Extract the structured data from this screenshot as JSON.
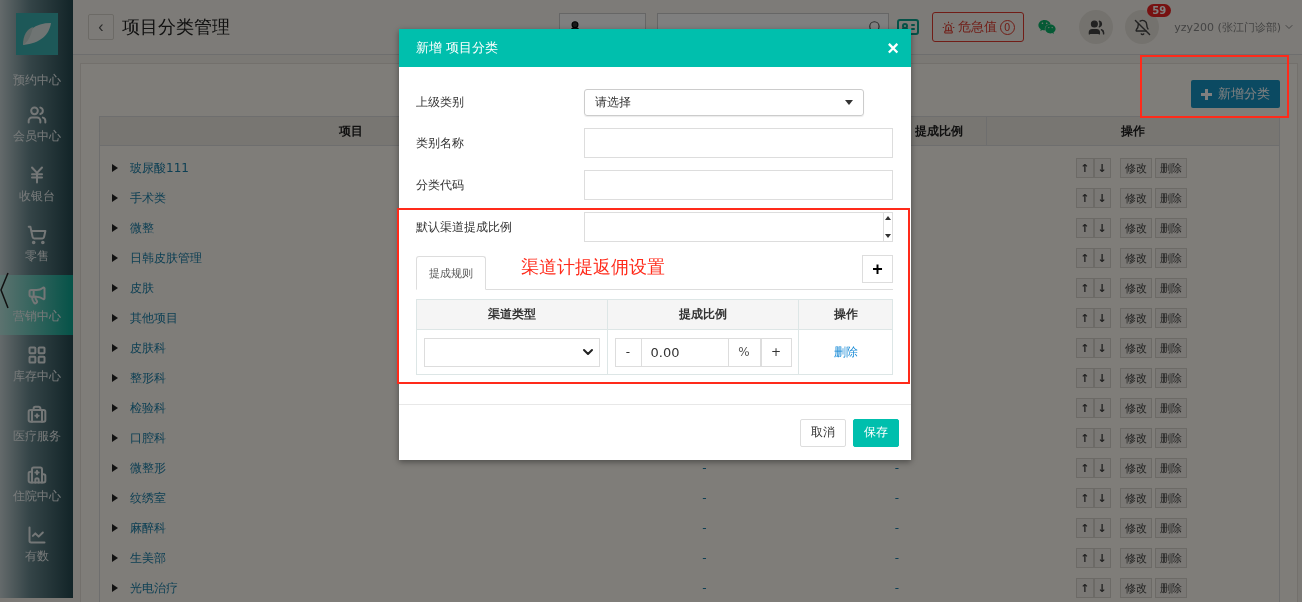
{
  "sidebar": {
    "items": [
      {
        "kind": "none",
        "label": "预约中心",
        "selected": false
      },
      {
        "kind": "users",
        "label": "会员中心",
        "selected": false
      },
      {
        "kind": "yen",
        "label": "收银台",
        "selected": false
      },
      {
        "kind": "cart",
        "label": "零售",
        "selected": false
      },
      {
        "kind": "megaphone",
        "label": "营销中心",
        "selected": true
      },
      {
        "kind": "grid",
        "label": "库存中心",
        "selected": false
      },
      {
        "kind": "medkit",
        "label": "医疗服务",
        "selected": false
      },
      {
        "kind": "hospital",
        "label": "住院中心",
        "selected": false
      },
      {
        "kind": "chart",
        "label": "有数",
        "selected": false
      }
    ]
  },
  "header": {
    "back": "‹",
    "title": "项目分类管理",
    "alert": {
      "label": "危急值",
      "count": "0"
    },
    "notifications": "59",
    "user": "yzy200 (张江门诊部)"
  },
  "new_category_button": {
    "label": "新增分类",
    "highlighted": true
  },
  "table": {
    "columns": [
      "项目",
      "",
      "提成比例",
      "操作"
    ],
    "rows": [
      {
        "name": "玻尿酸111",
        "actions": [
          "↑",
          "↓",
          "修改",
          "删除"
        ]
      },
      {
        "name": "手术类",
        "actions": [
          "↑",
          "↓",
          "修改",
          "删除"
        ]
      },
      {
        "name": "微整",
        "actions": [
          "↑",
          "↓",
          "修改",
          "删除"
        ]
      },
      {
        "name": "日韩皮肤管理",
        "actions": [
          "↑",
          "↓",
          "修改",
          "删除"
        ]
      },
      {
        "name": "皮肤",
        "actions": [
          "↑",
          "↓",
          "修改",
          "删除"
        ]
      },
      {
        "name": "其他项目",
        "actions": [
          "↑",
          "↓",
          "修改",
          "删除"
        ]
      },
      {
        "name": "皮肤科",
        "actions": [
          "↑",
          "↓",
          "修改",
          "删除"
        ]
      },
      {
        "name": "整形科",
        "actions": [
          "↑",
          "↓",
          "修改",
          "删除"
        ]
      },
      {
        "name": "检验科",
        "actions": [
          "↑",
          "↓",
          "修改",
          "删除"
        ]
      },
      {
        "name": "口腔科",
        "actions": [
          "↑",
          "↓",
          "修改",
          "删除"
        ]
      },
      {
        "name": "微整形",
        "column_2": "-",
        "column_3": "-",
        "actions": [
          "↑",
          "↓",
          "修改",
          "删除"
        ]
      },
      {
        "name": "纹绣室",
        "column_2": "-",
        "column_3": "-",
        "actions": [
          "↑",
          "↓",
          "修改",
          "删除"
        ]
      },
      {
        "name": "麻醉科",
        "column_2": "-",
        "column_3": "-",
        "actions": [
          "↑",
          "↓",
          "修改",
          "删除"
        ]
      },
      {
        "name": "生美部",
        "column_2": "-",
        "column_3": "-",
        "actions": [
          "↑",
          "↓",
          "修改",
          "删除"
        ]
      },
      {
        "name": "光电治疗",
        "column_2": "-",
        "column_3": "-",
        "actions": [
          "↑",
          "↓",
          "修改",
          "删除"
        ]
      }
    ]
  },
  "modal": {
    "title": "新增 项目分类",
    "close": "×",
    "fields": [
      {
        "kind": "select",
        "label": "上级类别",
        "value": "请选择"
      },
      {
        "kind": "text",
        "label": "类别名称"
      },
      {
        "kind": "text",
        "label": "分类代码"
      },
      {
        "kind": "number",
        "label": "默认渠道提成比例"
      }
    ],
    "rules": {
      "highlighted": true,
      "note": "渠道计提返佣设置",
      "tabs": [
        {
          "label": "提成规则",
          "selected": true
        }
      ],
      "add": "+",
      "columns": [
        "渠道类型",
        "提成比例",
        "操作"
      ],
      "rows": [
        {
          "minus": "-",
          "value": "0.00",
          "unit": "%",
          "plus": "+",
          "action": "删除"
        }
      ]
    },
    "buttons": [
      {
        "kind": "secondary",
        "label": "取消"
      },
      {
        "kind": "primary",
        "label": "保存"
      }
    ]
  }
}
